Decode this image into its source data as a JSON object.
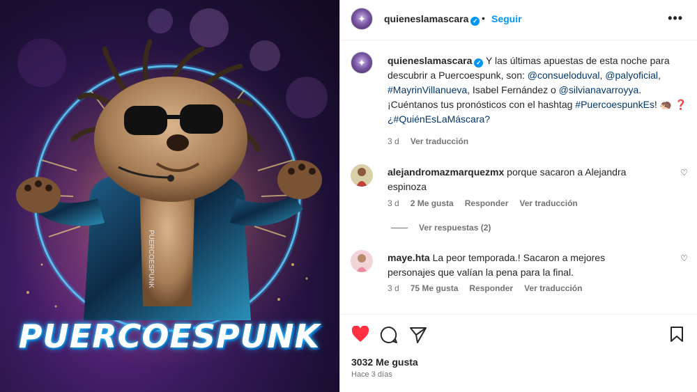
{
  "media": {
    "title": "PUERCOESPUNK",
    "jacket_text": "PUERCOESPUNK"
  },
  "post": {
    "username": "quieneslamascara",
    "verified_icon": "verified-badge-icon",
    "separator": "•",
    "follow_label": "Seguir",
    "more_label": "•••"
  },
  "caption": {
    "username": "quieneslamascara",
    "text_1": " Y las últimas apuestas de esta noche para descubrir a Puercoespunk, son: ",
    "mention_1": "@consueloduval",
    "sep_1": ", ",
    "mention_2": "@palyoficial",
    "sep_2": ", ",
    "hashtag_1": "#MayrinVillanueva",
    "text_2": ", Isabel Fernández o ",
    "mention_3": "@silvianavarroyya",
    "text_3": ". ¡Cuéntanos tus pronósticos con el hashtag ",
    "hashtag_2": "#PuercoespunkEs",
    "text_4": "! 🦔 ❓ ",
    "hashtag_3": "¿#QuiénEsLaMáscara?",
    "time": "3 d",
    "translate": "Ver traducción"
  },
  "comments": [
    {
      "username": "alejandromazmarquezmx",
      "text": " porque sacaron a Alejandra espinoza",
      "time": "3 d",
      "likes": "2 Me gusta",
      "reply": "Responder",
      "translate": "Ver traducción"
    },
    {
      "username": "maye.hta",
      "text": " La peor temporada.! Sacaron a mejores personajes que valían la pena para la final.",
      "time": "3 d",
      "likes": "75 Me gusta",
      "reply": "Responder",
      "translate": "Ver traducción"
    }
  ],
  "replies_label": "Ver respuestas (2)",
  "footer": {
    "likes": "3032 Me gusta",
    "ago": "Hace 3 días"
  },
  "colors": {
    "accent": "#0095f6",
    "link": "#00376b",
    "like_red": "#ff3040",
    "muted": "#737373"
  }
}
